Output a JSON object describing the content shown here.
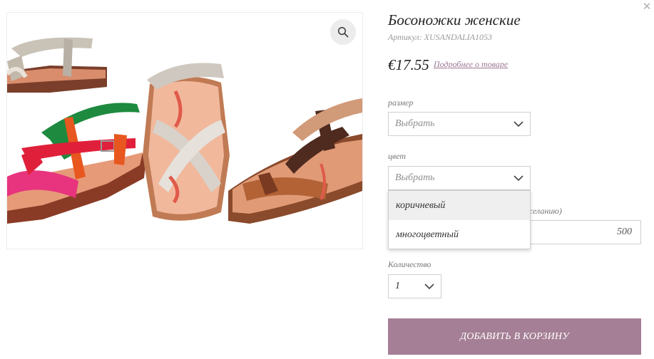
{
  "product": {
    "title": "Босоножки женские",
    "sku": "Артикул: XUSANDALIA1053",
    "price": "€17.55",
    "details_link": "Подробнее о товаре"
  },
  "options": {
    "size": {
      "label": "размер",
      "value": "Выбрать"
    },
    "color": {
      "label": "цвет",
      "value": "Выбрать",
      "dropdown_open": true,
      "items": [
        "коричневый",
        "многоцветный"
      ],
      "highlighted_index": 0
    },
    "wish": {
      "label_visible_part": "желанию)",
      "value": "500"
    },
    "quantity": {
      "label": "Количество",
      "value": "1"
    }
  },
  "actions": {
    "add_to_cart": "ДОБАВИТЬ В КОРЗИНУ"
  },
  "icons": {
    "zoom": "magnifier-icon",
    "close": "close-icon",
    "chevron": "chevron-down-icon"
  },
  "colors": {
    "accent": "#a57f96",
    "link": "#9a7590",
    "border": "#cfcfcf"
  }
}
